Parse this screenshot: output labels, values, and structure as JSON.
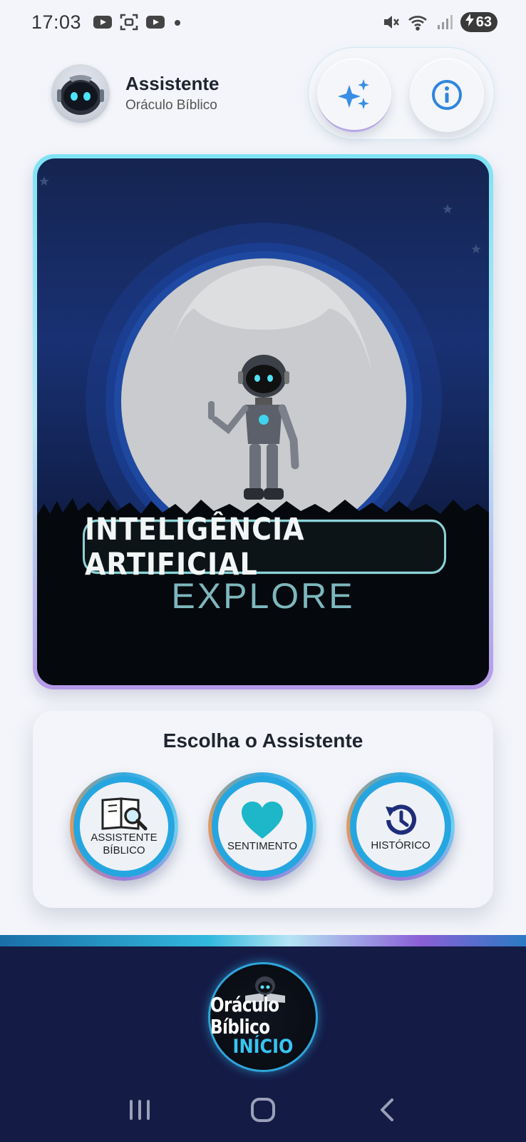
{
  "status_bar": {
    "time": "17:03",
    "battery": "63",
    "icons": [
      "youtube-icon",
      "screenshot-icon",
      "youtube-icon",
      "dot-icon",
      "mute-icon",
      "wifi-icon",
      "signal-icon",
      "battery-charging-icon"
    ]
  },
  "header": {
    "title": "Assistente",
    "subtitle": "Oráculo Bíblico",
    "actions": [
      "sparkle-icon",
      "info-icon"
    ]
  },
  "hero": {
    "badge_text": "INTELIGÊNCIA ARTIFICIAL",
    "explore_text": "EXPLORE"
  },
  "chooser": {
    "title": "Escolha o Assistente",
    "buttons": [
      {
        "label_line1": "ASSISTENTE",
        "label_line2": "BÍBLICO",
        "icon": "book-search-icon"
      },
      {
        "label_line1": "SENTIMENTO",
        "label_line2": "",
        "icon": "heart-icon"
      },
      {
        "label_line1": "HISTÓRICO",
        "label_line2": "",
        "icon": "history-icon"
      }
    ]
  },
  "bottom": {
    "home_title": "Oráculo Bíblico",
    "home_sub": "INÍCIO"
  },
  "colors": {
    "accent_blue": "#26a6e0",
    "navy": "#141b45",
    "bg": "#f3f5fa"
  }
}
